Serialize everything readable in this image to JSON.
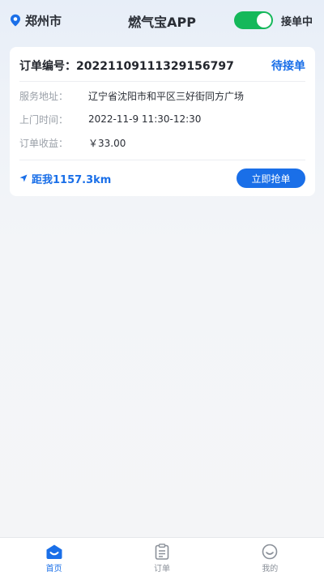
{
  "header": {
    "city": "郑州市",
    "app_title": "燃气宝APP",
    "toggle_label": "接单中",
    "toggle_on": true
  },
  "order": {
    "order_no_label": "订单编号：",
    "order_no": "20221109111329156797",
    "status": "待接单",
    "address_label": "服务地址：",
    "address": "辽宁省沈阳市和平区三好街同方广场",
    "time_label": "上门时间：",
    "time": "2022-11-9 11:30-12:30",
    "income_label": "订单收益：",
    "income": "￥33.00",
    "distance": "距我1157.3km",
    "grab_label": "立即抢单"
  },
  "tabs": [
    {
      "label": "首页",
      "icon": "home-icon",
      "active": true
    },
    {
      "label": "订单",
      "icon": "clipboard-icon",
      "active": false
    },
    {
      "label": "我的",
      "icon": "smiley-icon",
      "active": false
    }
  ],
  "colors": {
    "accent": "#1a6fe8",
    "toggle_on": "#15b85a"
  }
}
